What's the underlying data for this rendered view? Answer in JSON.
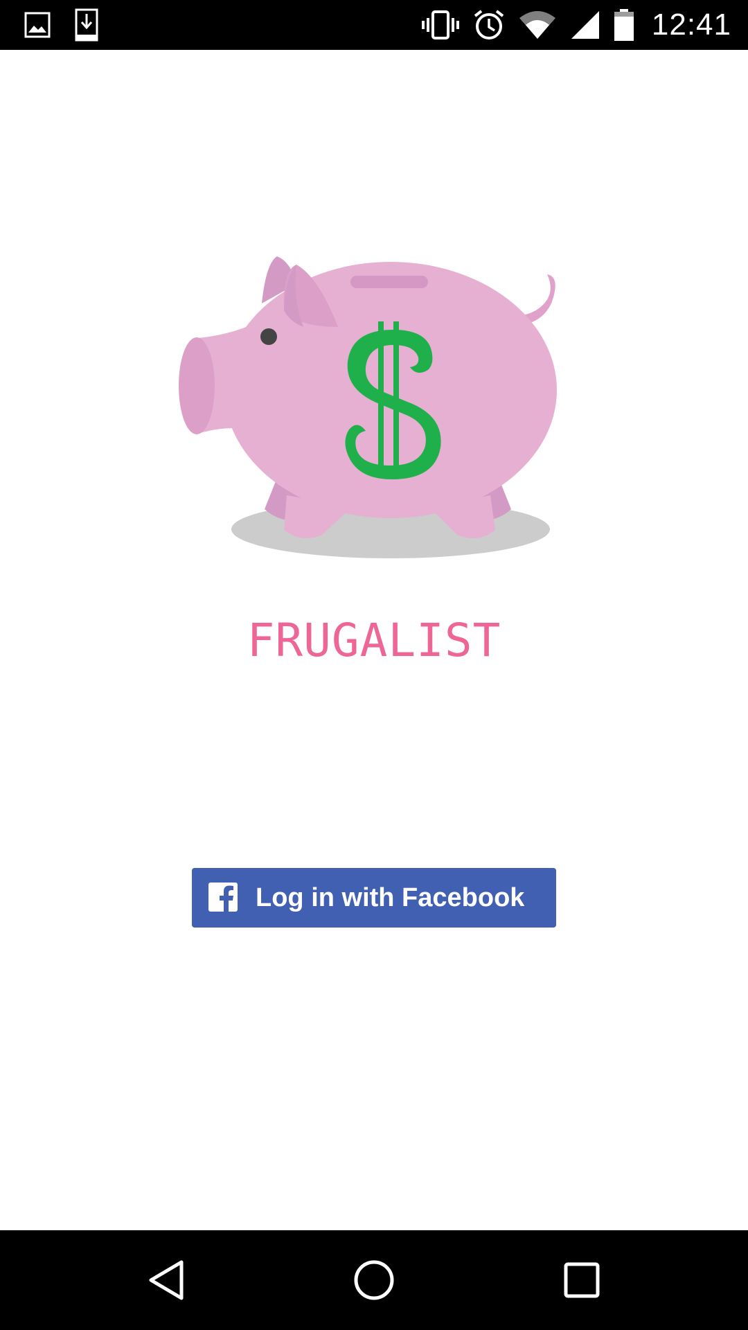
{
  "status_bar": {
    "time": "12:41",
    "left_icons": [
      "image-icon",
      "download-icon"
    ],
    "right_icons": [
      "vibrate-icon",
      "alarm-icon",
      "wifi-icon",
      "cellular-signal-icon",
      "battery-icon"
    ]
  },
  "app": {
    "title": "FRUGALIST",
    "logo": "piggy-bank-icon"
  },
  "login": {
    "facebook_button_label": "Log in with Facebook",
    "facebook_icon": "facebook-icon"
  },
  "navigation": {
    "buttons": [
      "back-icon",
      "home-icon",
      "recents-icon"
    ]
  },
  "colors": {
    "title": "#ee6696",
    "facebook_blue": "#4260b1",
    "pig_pink": "#e6b0d2",
    "dollar_green": "#20b04b",
    "shadow_gray": "#cccccc"
  }
}
